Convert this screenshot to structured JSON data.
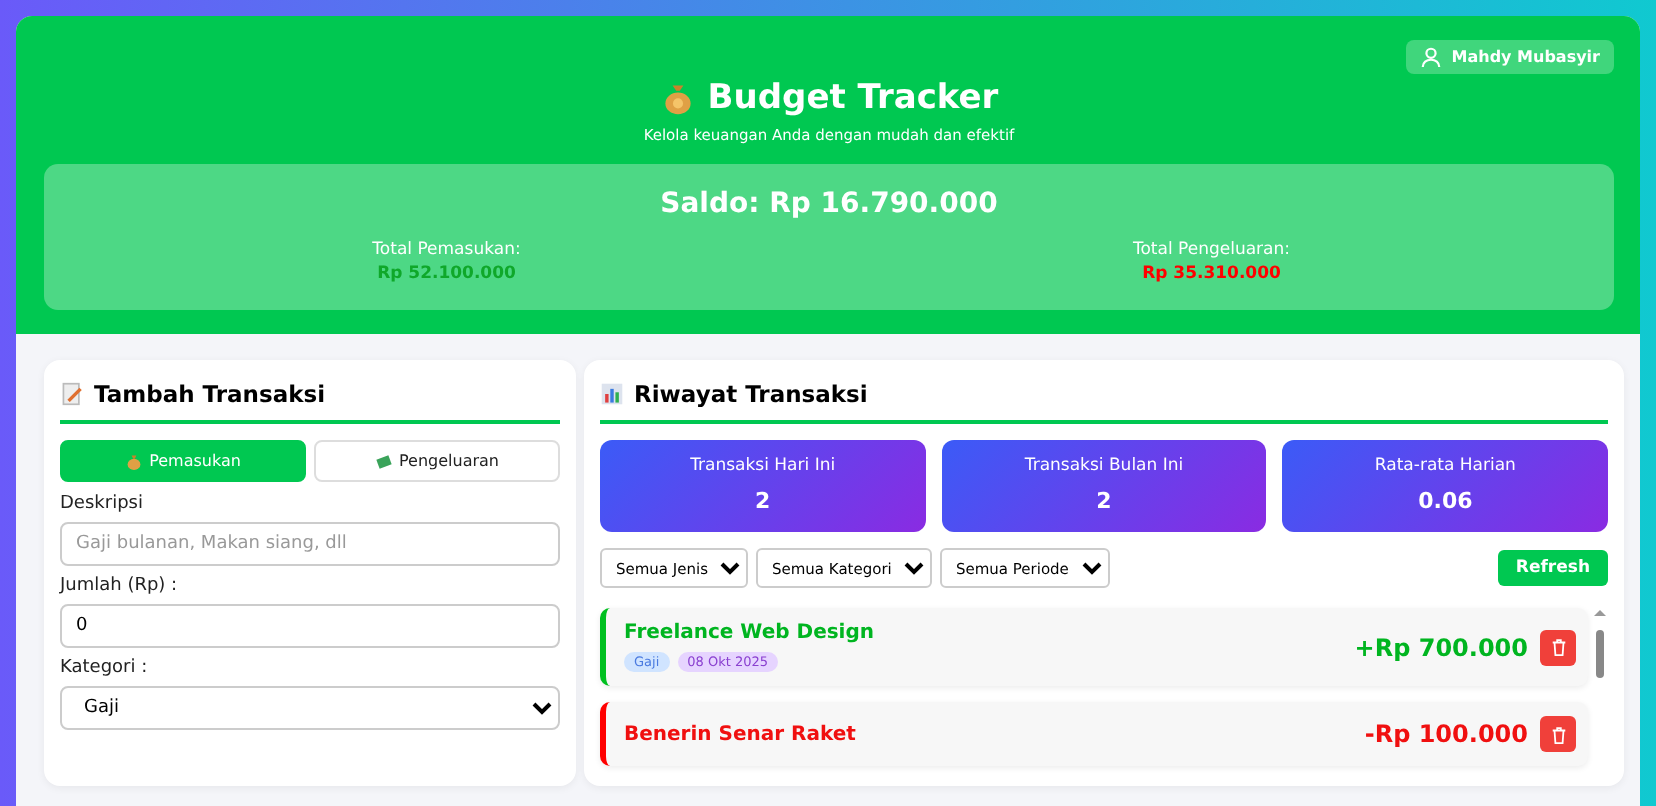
{
  "user": {
    "name": "Mahdy Mubasyir"
  },
  "header": {
    "title": "Budget Tracker",
    "subtitle": "Kelola keuangan Anda dengan mudah dan efektif"
  },
  "summary": {
    "balance": "Saldo: Rp 16.790.000",
    "totals": [
      {
        "label": "Total Pemasukan:",
        "value": "Rp 52.100.000",
        "kind": "income"
      },
      {
        "label": "Total Pengeluaran:",
        "value": "Rp 35.310.000",
        "kind": "expense"
      }
    ]
  },
  "form": {
    "title": "Tambah Transaksi",
    "types": [
      {
        "label": "Pemasukan",
        "selected": true
      },
      {
        "label": "Pengeluaran",
        "selected": false
      }
    ],
    "fields": [
      {
        "label": "Deskripsi",
        "kind": "text",
        "placeholder": "Gaji bulanan, Makan siang, dll"
      },
      {
        "label": "Jumlah (Rp) :",
        "kind": "number",
        "value": "0"
      },
      {
        "label": "Kategori :",
        "kind": "select",
        "value": "Gaji"
      }
    ]
  },
  "history": {
    "title": "Riwayat Transaksi",
    "stats": [
      {
        "label": "Transaksi Hari Ini",
        "value": "2"
      },
      {
        "label": "Transaksi Bulan Ini",
        "value": "2"
      },
      {
        "label": "Rata-rata Harian",
        "value": "0.06"
      }
    ],
    "filters": [
      "Semua Jenis",
      "Semua Kategori",
      "Semua Periode"
    ],
    "refresh": "Refresh",
    "transactions": [
      {
        "title": "Freelance Web Design",
        "kind": "income",
        "amount": "+Rp 700.000",
        "category": "Gaji",
        "date": "08 Okt 2025"
      },
      {
        "title": "Benerin Senar Raket",
        "kind": "expense",
        "amount": "-Rp 100.000"
      }
    ]
  }
}
